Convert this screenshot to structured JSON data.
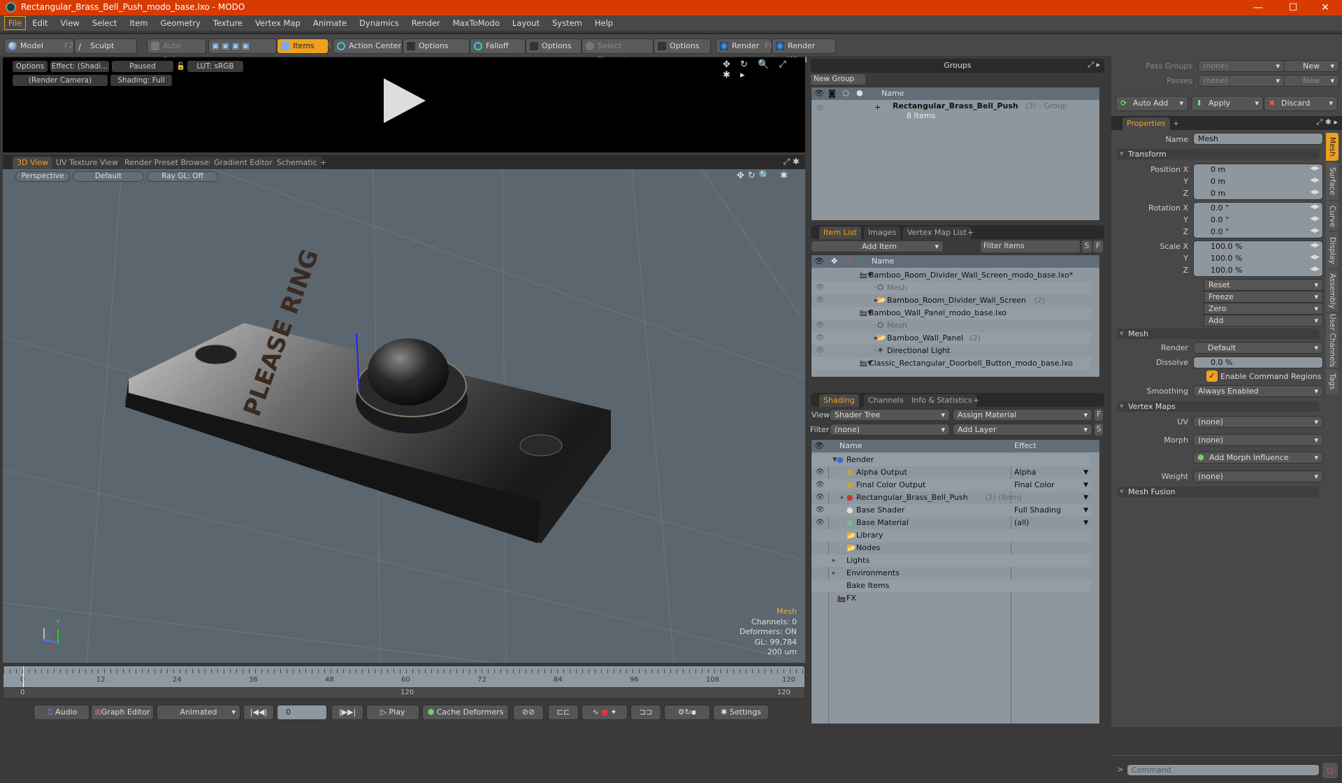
{
  "window": {
    "title": "Rectangular_Brass_Bell_Push_modo_base.lxo - MODO",
    "controls": [
      "—",
      "☐",
      "✕"
    ]
  },
  "menubar": [
    "File",
    "Edit",
    "View",
    "Select",
    "Item",
    "Geometry",
    "Texture",
    "Vertex Map",
    "Animate",
    "Dynamics",
    "Render",
    "MaxToModo",
    "Layout",
    "System",
    "Help"
  ],
  "toolbar": {
    "model": "Model",
    "model_key": "F2",
    "sculpt": "Sculpt",
    "auto_select": "Auto Select",
    "items": "Items",
    "items_count": "5",
    "action_center": "Action Center",
    "options1": "Options",
    "falloff": "Falloff",
    "options2": "Options",
    "select_through": "Select Through",
    "options3": "Options",
    "render": "Render",
    "render_key": "F9",
    "render_window": "Render Window"
  },
  "render_view": {
    "options": "Options",
    "effect": "Effect: (Shadi...",
    "paused": "Paused",
    "lut": "LUT: sRGB",
    "camera": "(Render Camera)",
    "shading": "Shading: Full",
    "icons": "✥ ↻ 🔍 ⤢ ✱ ▸"
  },
  "viewport_tabs": [
    "3D View",
    "UV Texture View",
    "Render Preset Browser",
    "Gradient Editor",
    "Schematic",
    "+"
  ],
  "viewport": {
    "perspective": "Perspective",
    "default": "Default",
    "raygl": "Ray GL: Off",
    "info": {
      "selection": "Mesh",
      "channels": "Channels: 0",
      "deformers": "Deformers: ON",
      "gl": "GL: 99,784",
      "scale": "200 um"
    },
    "axis": {
      "x": "X",
      "y": "Y",
      "z": "Z"
    },
    "model_text": "PLEASE RING"
  },
  "timeline": {
    "ticks": [
      "0",
      "12",
      "24",
      "36",
      "48",
      "60",
      "72",
      "84",
      "96",
      "108",
      "120"
    ],
    "range_start": "0",
    "range_mid": "120",
    "range_end": "120"
  },
  "transport": {
    "audio": "Audio",
    "graph_editor": "Graph Editor",
    "animated": "Animated",
    "frame": "0",
    "play": "Play",
    "cache_deformers": "Cache Deformers",
    "settings": "Settings"
  },
  "groups": {
    "title": "Groups",
    "new_group": "New Group",
    "col_name": "Name",
    "items": [
      {
        "name": "Rectangular_Brass_Bell_Push",
        "count": "(3)",
        "type": ": Group",
        "sub": "8 Items"
      }
    ]
  },
  "item_list": {
    "tabs": [
      "Item List",
      "Images",
      "Vertex Map List",
      "+"
    ],
    "add_item": "Add Item",
    "filter_placeholder": "Filter Items",
    "s": "S",
    "f": "F",
    "col_name": "Name",
    "rows": [
      {
        "name": "Bamboo_Room_Divider_Wall_Screen_modo_base.lxo*",
        "level": 0,
        "eye": false,
        "dim": false,
        "count": ""
      },
      {
        "name": "Mesh",
        "level": 1,
        "eye": true,
        "dim": true,
        "count": ""
      },
      {
        "name": "Bamboo_Room_Divider_Wall_Screen",
        "level": 1,
        "eye": true,
        "dim": false,
        "count": "(2)"
      },
      {
        "name": "Bamboo_Wall_Panel_modo_base.lxo",
        "level": 0,
        "eye": false,
        "dim": false,
        "count": ""
      },
      {
        "name": "Mesh",
        "level": 1,
        "eye": true,
        "dim": true,
        "count": ""
      },
      {
        "name": "Bamboo_Wall_Panel",
        "level": 1,
        "eye": true,
        "dim": false,
        "count": "(2)"
      },
      {
        "name": "Directional Light",
        "level": 1,
        "eye": true,
        "dim": false,
        "count": ""
      },
      {
        "name": "Classic_Rectangular_Doorbell_Button_modo_base.lxo",
        "level": 0,
        "eye": false,
        "dim": false,
        "count": ""
      }
    ]
  },
  "shading": {
    "tabs": [
      "Shading",
      "Channels",
      "Info & Statistics",
      "+"
    ],
    "view_label": "View",
    "view_value": "Shader Tree",
    "assign_material": "Assign Material",
    "f": "F",
    "filter_label": "Filter",
    "filter_value": "(none)",
    "add_layer": "Add Layer",
    "s": "S",
    "col_name": "Name",
    "col_effect": "Effect",
    "rows": [
      {
        "name": "Render",
        "effect": "",
        "eye": false,
        "level": 0,
        "suffix": ""
      },
      {
        "name": "Alpha Output",
        "effect": "Alpha",
        "eye": true,
        "level": 1,
        "suffix": ""
      },
      {
        "name": "Final Color Output",
        "effect": "Final Color",
        "eye": true,
        "level": 1,
        "suffix": ""
      },
      {
        "name": "Rectangular_Brass_Bell_Push",
        "effect": "",
        "eye": true,
        "level": 1,
        "suffix": "(2) (Item)"
      },
      {
        "name": "Base Shader",
        "effect": "Full Shading",
        "eye": true,
        "level": 1,
        "suffix": ""
      },
      {
        "name": "Base Material",
        "effect": "(all)",
        "eye": true,
        "level": 1,
        "suffix": ""
      },
      {
        "name": "Library",
        "effect": "",
        "eye": false,
        "level": 1,
        "suffix": ""
      },
      {
        "name": "Nodes",
        "effect": "",
        "eye": false,
        "level": 1,
        "suffix": ""
      },
      {
        "name": "Lights",
        "effect": "",
        "eye": false,
        "level": 0,
        "suffix": ""
      },
      {
        "name": "Environments",
        "effect": "",
        "eye": false,
        "level": 0,
        "suffix": ""
      },
      {
        "name": "Bake Items",
        "effect": "",
        "eye": false,
        "level": 0,
        "suffix": ""
      },
      {
        "name": "FX",
        "effect": "",
        "eye": false,
        "level": 0,
        "suffix": ""
      }
    ]
  },
  "passes": {
    "pass_groups_label": "Pass Groups",
    "pass_groups_value": "(none)",
    "new1": "New",
    "passes_label": "Passes",
    "passes_value": "(none)",
    "new2": "New",
    "auto_add": "Auto Add",
    "apply": "Apply",
    "discard": "Discard"
  },
  "properties": {
    "tab": "Properties",
    "plus": "+",
    "name_label": "Name",
    "name_value": "Mesh",
    "transform": "Transform",
    "position": [
      "0 m",
      "0 m",
      "0 m"
    ],
    "rotation": [
      "0.0 °",
      "0.0 °",
      "0.0 °"
    ],
    "scale": [
      "100.0 %",
      "100.0 %",
      "100.0 %"
    ],
    "labels": {
      "px": "Position X",
      "rx": "Rotation X",
      "sx": "Scale X",
      "y": "Y",
      "z": "Z"
    },
    "actions": [
      "Reset",
      "Freeze",
      "Zero",
      "Add"
    ],
    "mesh_section": "Mesh",
    "render_label": "Render",
    "render_value": "Default",
    "dissolve_label": "Dissolve",
    "dissolve_value": "0.0 %",
    "enable_cmd_regions": "Enable Command Regions",
    "enable_cmd_regions_checked": true,
    "smoothing_label": "Smoothing",
    "smoothing_value": "Always Enabled",
    "vertex_maps": "Vertex Maps",
    "uv_label": "UV",
    "uv_value": "(none)",
    "morph_label": "Morph",
    "morph_value": "(none)",
    "add_morph": "Add Morph Influence",
    "weight_label": "Weight",
    "weight_value": "(none)",
    "mesh_fusion": "Mesh Fusion",
    "side_tabs": [
      "Mesh",
      "Surface",
      "Curve",
      "Display",
      "Assembly",
      "User Channels",
      "Tags"
    ]
  },
  "command": {
    "prompt": ">",
    "placeholder": "Command"
  },
  "colors": {
    "accent": "#f0a020",
    "titlebar": "#d83b01"
  }
}
